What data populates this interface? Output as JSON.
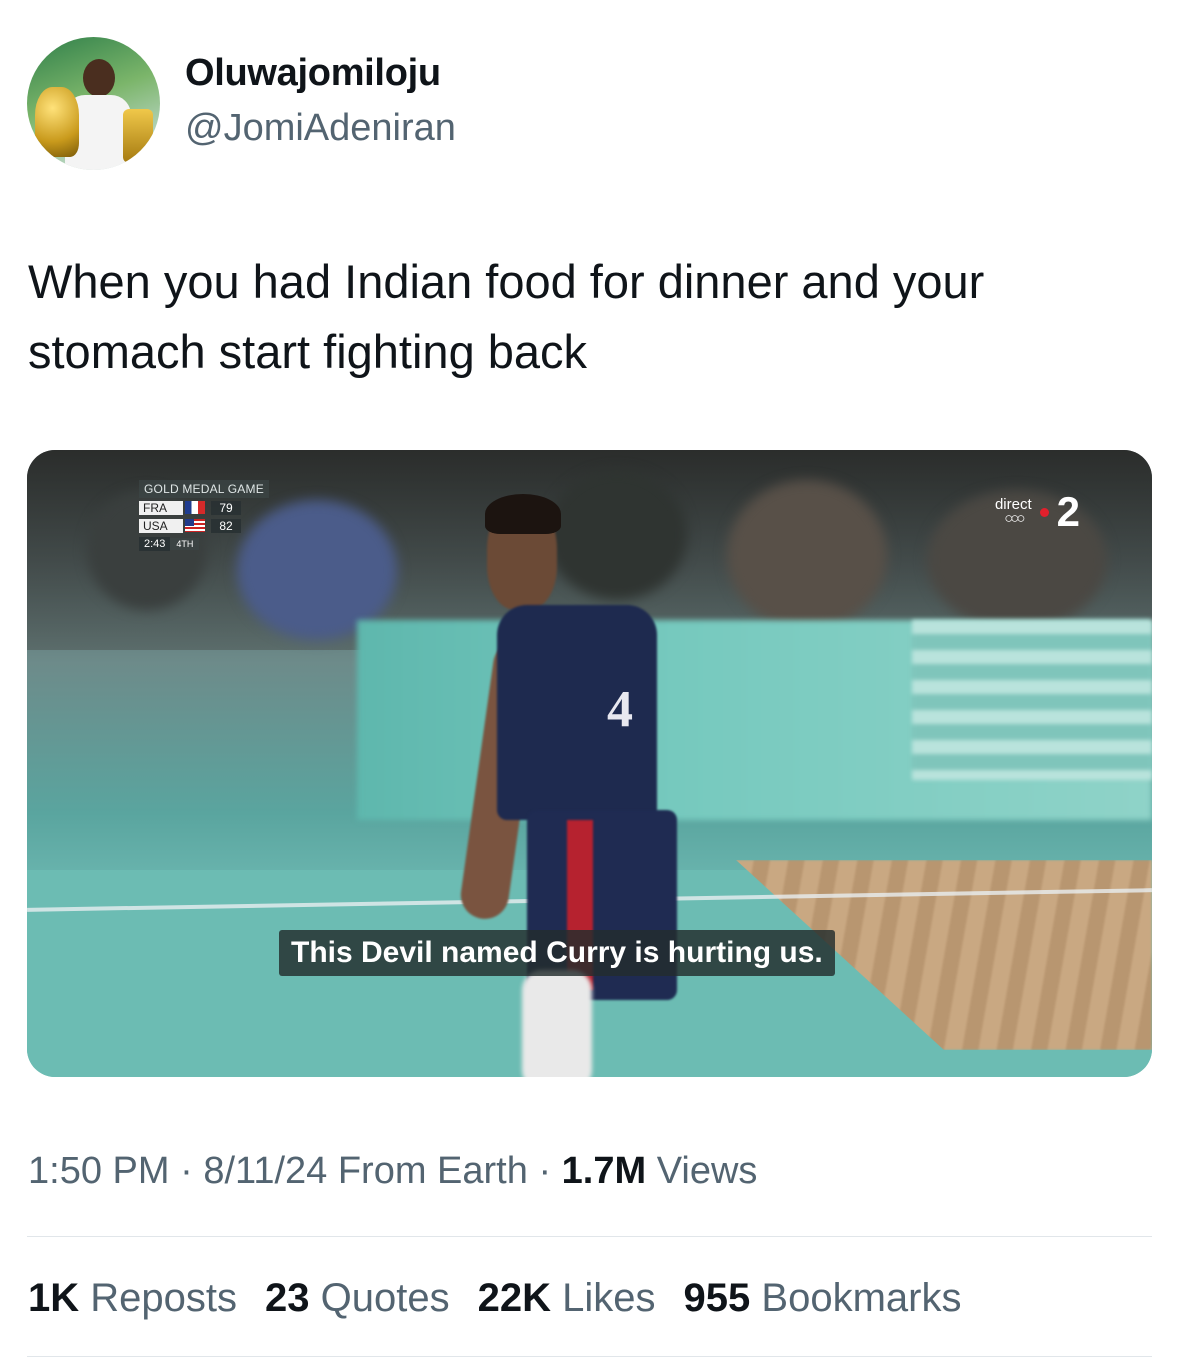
{
  "author": {
    "display_name": "Oluwajomiloju",
    "handle": "@JomiAdeniran"
  },
  "tweet": {
    "text": "When you had Indian food for dinner and your stomach start fighting back"
  },
  "media": {
    "scorebug": {
      "title": "GOLD MEDAL GAME",
      "team1": "FRA",
      "team1_score": "79",
      "team2": "USA",
      "team2_score": "82",
      "clock": "2:43",
      "period": "4TH"
    },
    "channel": {
      "label": "direct",
      "number": "2"
    },
    "jersey_number": "4",
    "subtitle": "This Devil named Curry is hurting us."
  },
  "meta": {
    "time": "1:50 PM",
    "sep1": " · ",
    "date": "8/11/24",
    "source": " From Earth",
    "sep2": " · ",
    "views_count": "1.7M",
    "views_label": " Views"
  },
  "stats": {
    "reposts_count": "1K",
    "reposts_label": "Reposts",
    "quotes_count": "23",
    "quotes_label": "Quotes",
    "likes_count": "22K",
    "likes_label": "Likes",
    "bookmarks_count": "955",
    "bookmarks_label": "Bookmarks"
  }
}
